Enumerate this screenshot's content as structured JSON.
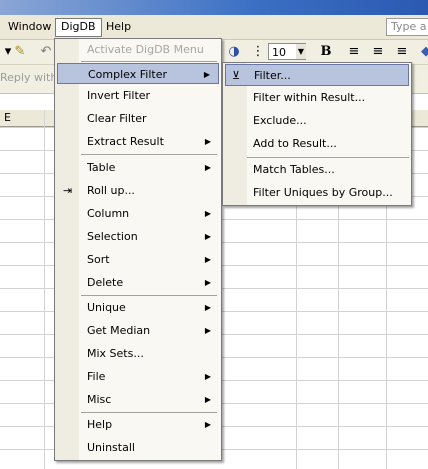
{
  "menubar": {
    "window": "Window",
    "digdb": "DigDB",
    "help": "Help",
    "type_box": "Type a"
  },
  "toolbar": {
    "font_size": "10",
    "bold": "B"
  },
  "reply_text": "Reply with C",
  "sheet": {
    "column_header": "E"
  },
  "main_menu": {
    "items": [
      {
        "label": "Activate DigDB Menu",
        "disabled": true
      },
      {
        "label": "Complex Filter",
        "submenu": true,
        "highlighted": true
      },
      {
        "label": "Invert Filter"
      },
      {
        "label": "Clear Filter"
      },
      {
        "label": "Extract Result",
        "submenu": true
      },
      {
        "label": "Table",
        "submenu": true
      },
      {
        "label": "Roll up...",
        "icon": "rollup-icon"
      },
      {
        "label": "Column",
        "submenu": true
      },
      {
        "label": "Selection",
        "submenu": true
      },
      {
        "label": "Sort",
        "submenu": true
      },
      {
        "label": "Delete",
        "submenu": true
      },
      {
        "label": "Unique",
        "submenu": true
      },
      {
        "label": "Get Median",
        "submenu": true
      },
      {
        "label": "Mix Sets..."
      },
      {
        "label": "File",
        "submenu": true
      },
      {
        "label": "Misc",
        "submenu": true
      },
      {
        "label": "Help",
        "submenu": true
      },
      {
        "label": "Uninstall"
      }
    ]
  },
  "sub_menu": {
    "items": [
      {
        "label": "Filter...",
        "highlighted": true,
        "icon": "filter-icon"
      },
      {
        "label": "Filter within Result..."
      },
      {
        "label": "Exclude..."
      },
      {
        "label": "Add to Result..."
      },
      {
        "label": "Match Tables..."
      },
      {
        "label": "Filter Uniques by Group..."
      }
    ]
  },
  "colors": {
    "menu_highlight": "#b8c3dd",
    "highlight_border": "#6a76a8",
    "disabled_text": "#a7a7a7"
  }
}
